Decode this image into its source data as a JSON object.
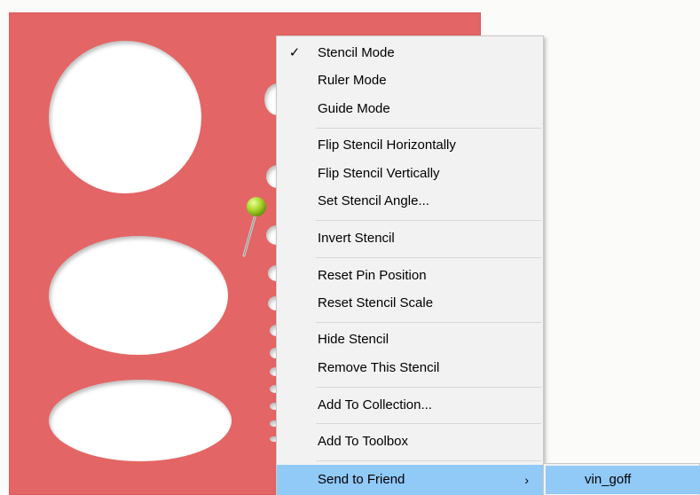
{
  "context_menu": {
    "items": [
      {
        "label": "Stencil Mode",
        "checked": true
      },
      {
        "label": "Ruler Mode"
      },
      {
        "label": "Guide Mode"
      },
      {
        "label": "Flip Stencil Horizontally"
      },
      {
        "label": "Flip Stencil Vertically"
      },
      {
        "label": "Set Stencil Angle..."
      },
      {
        "label": "Invert Stencil"
      },
      {
        "label": "Reset Pin Position"
      },
      {
        "label": "Reset Stencil Scale"
      },
      {
        "label": "Hide Stencil"
      },
      {
        "label": "Remove This Stencil"
      },
      {
        "label": "Add To Collection..."
      },
      {
        "label": "Add To Toolbox"
      },
      {
        "label": "Send to Friend",
        "has_submenu": true,
        "highlighted": true
      }
    ],
    "check_glyph": "✓",
    "submenu_arrow": "›"
  },
  "submenu": {
    "items": [
      {
        "label": "vin_goff",
        "highlighted": true
      }
    ]
  },
  "colors": {
    "stencil": "#e46565",
    "menu_bg": "#f2f2f2",
    "highlight": "#91c9f7",
    "pin_head": "#a8d62a"
  }
}
